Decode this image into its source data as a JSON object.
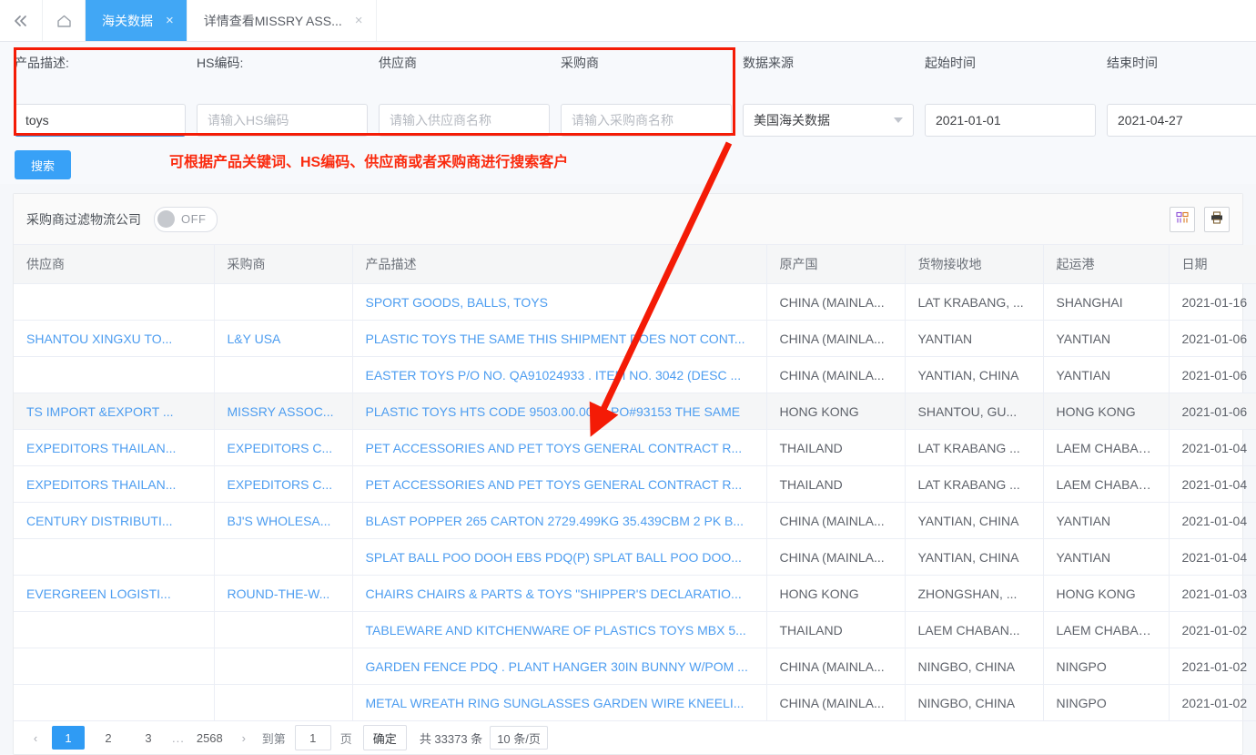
{
  "tabbar": {
    "collapse_icon": "double-chevron-left-icon",
    "home_icon": "home-icon",
    "tabs": [
      {
        "label": "海关数据",
        "close": "×",
        "active": true
      },
      {
        "label": "详情查看MISSRY ASS...",
        "close": "×",
        "active": false
      }
    ]
  },
  "search": {
    "fields": [
      {
        "label": "产品描述:",
        "value": "toys",
        "placeholder": "",
        "focused": true
      },
      {
        "label": "HS编码:",
        "value": "",
        "placeholder": "请输入HS编码",
        "focused": false
      },
      {
        "label": "供应商",
        "value": "",
        "placeholder": "请输入供应商名称",
        "focused": false
      },
      {
        "label": "采购商",
        "value": "",
        "placeholder": "请输入采购商名称",
        "focused": false
      }
    ],
    "source": {
      "label": "数据来源",
      "value": "美国海关数据",
      "caret": "chevron-down-icon"
    },
    "start": {
      "label": "起始时间",
      "value": "2021-01-01"
    },
    "end": {
      "label": "结束时间",
      "value": "2021-04-27"
    },
    "button_label": "搜索"
  },
  "annotation": {
    "text": "可根据产品关键词、HS编码、供应商或者采购商进行搜索客户",
    "color": "#fa2a0e"
  },
  "toolbar": {
    "filter_label": "采购商过滤物流公司",
    "switch_state": "OFF",
    "columns_icon": "columns-settings-icon",
    "export_icon": "print-export-icon"
  },
  "table": {
    "columns": [
      "供应商",
      "采购商",
      "产品描述",
      "原产国",
      "货物接收地",
      "起运港",
      "日期"
    ],
    "rows": [
      [
        "",
        "",
        "SPORT GOODS, BALLS, TOYS",
        "CHINA (MAINLA...",
        "LAT KRABANG, ...",
        "SHANGHAI",
        "2021-01-16"
      ],
      [
        "SHANTOU XINGXU TO...",
        "L&Y USA",
        "PLASTIC TOYS THE SAME THIS SHIPMENT DOES NOT CONT...",
        "CHINA (MAINLA...",
        "YANTIAN",
        "YANTIAN",
        "2021-01-06"
      ],
      [
        "",
        "",
        "EASTER TOYS P/O NO. QA91024933 . ITEM NO. 3042 (DESC ...",
        "CHINA (MAINLA...",
        "YANTIAN, CHINA",
        "YANTIAN",
        "2021-01-06"
      ],
      [
        "TS IMPORT &EXPORT ...",
        "MISSRY ASSOC...",
        "PLASTIC TOYS HTS CODE 9503.00.0073 PO#93153 THE SAME",
        "HONG KONG",
        "SHANTOU, GU...",
        "HONG KONG",
        "2021-01-06"
      ],
      [
        "EXPEDITORS THAILAN...",
        "EXPEDITORS C...",
        "PET ACCESSORIES AND PET TOYS GENERAL CONTRACT R...",
        "THAILAND",
        "LAT KRABANG ...",
        "LAEM CHABANG",
        "2021-01-04"
      ],
      [
        "EXPEDITORS THAILAN...",
        "EXPEDITORS C...",
        "PET ACCESSORIES AND PET TOYS GENERAL CONTRACT R...",
        "THAILAND",
        "LAT KRABANG ...",
        "LAEM CHABANG",
        "2021-01-04"
      ],
      [
        "CENTURY DISTRIBUTI...",
        "BJ'S WHOLESA...",
        "BLAST POPPER 265 CARTON 2729.499KG 35.439CBM 2 PK B...",
        "CHINA (MAINLA...",
        "YANTIAN, CHINA",
        "YANTIAN",
        "2021-01-04"
      ],
      [
        "",
        "",
        "SPLAT BALL POO DOOH EBS PDQ(P) SPLAT BALL POO DOO...",
        "CHINA (MAINLA...",
        "YANTIAN, CHINA",
        "YANTIAN",
        "2021-01-04"
      ],
      [
        "EVERGREEN LOGISTI...",
        "ROUND-THE-W...",
        "CHAIRS CHAIRS & PARTS & TOYS \"SHIPPER'S DECLARATIO...",
        "HONG KONG",
        "ZHONGSHAN, ...",
        "HONG KONG",
        "2021-01-03"
      ],
      [
        "",
        "",
        "TABLEWARE AND KITCHENWARE OF PLASTICS TOYS MBX 5...",
        "THAILAND",
        "LAEM CHABAN...",
        "LAEM CHABANG",
        "2021-01-02"
      ],
      [
        "",
        "",
        "GARDEN FENCE PDQ . PLANT HANGER 30IN BUNNY W/POM ...",
        "CHINA (MAINLA...",
        "NINGBO, CHINA",
        "NINGPO",
        "2021-01-02"
      ],
      [
        "",
        "",
        "METAL WREATH RING SUNGLASSES GARDEN WIRE KNEELI...",
        "CHINA (MAINLA...",
        "NINGBO, CHINA",
        "NINGPO",
        "2021-01-02"
      ]
    ],
    "link_columns": [
      0,
      1,
      2
    ],
    "alt_rows": [
      3
    ]
  },
  "pagination": {
    "prev": "‹",
    "next": "›",
    "pages": [
      "1",
      "2",
      "3"
    ],
    "dots": "...",
    "last_page": "2568",
    "current": "1",
    "goto_prefix": "到第",
    "goto_value": "1",
    "goto_suffix": "页",
    "confirm": "确定",
    "total": "共 33373 条",
    "page_size": "10 条/页"
  },
  "colors": {
    "accent": "#38a1f7",
    "link": "#4d9df0",
    "annotation_red": "#fa2a0e",
    "tab_active_bg": "#41a7f5"
  }
}
